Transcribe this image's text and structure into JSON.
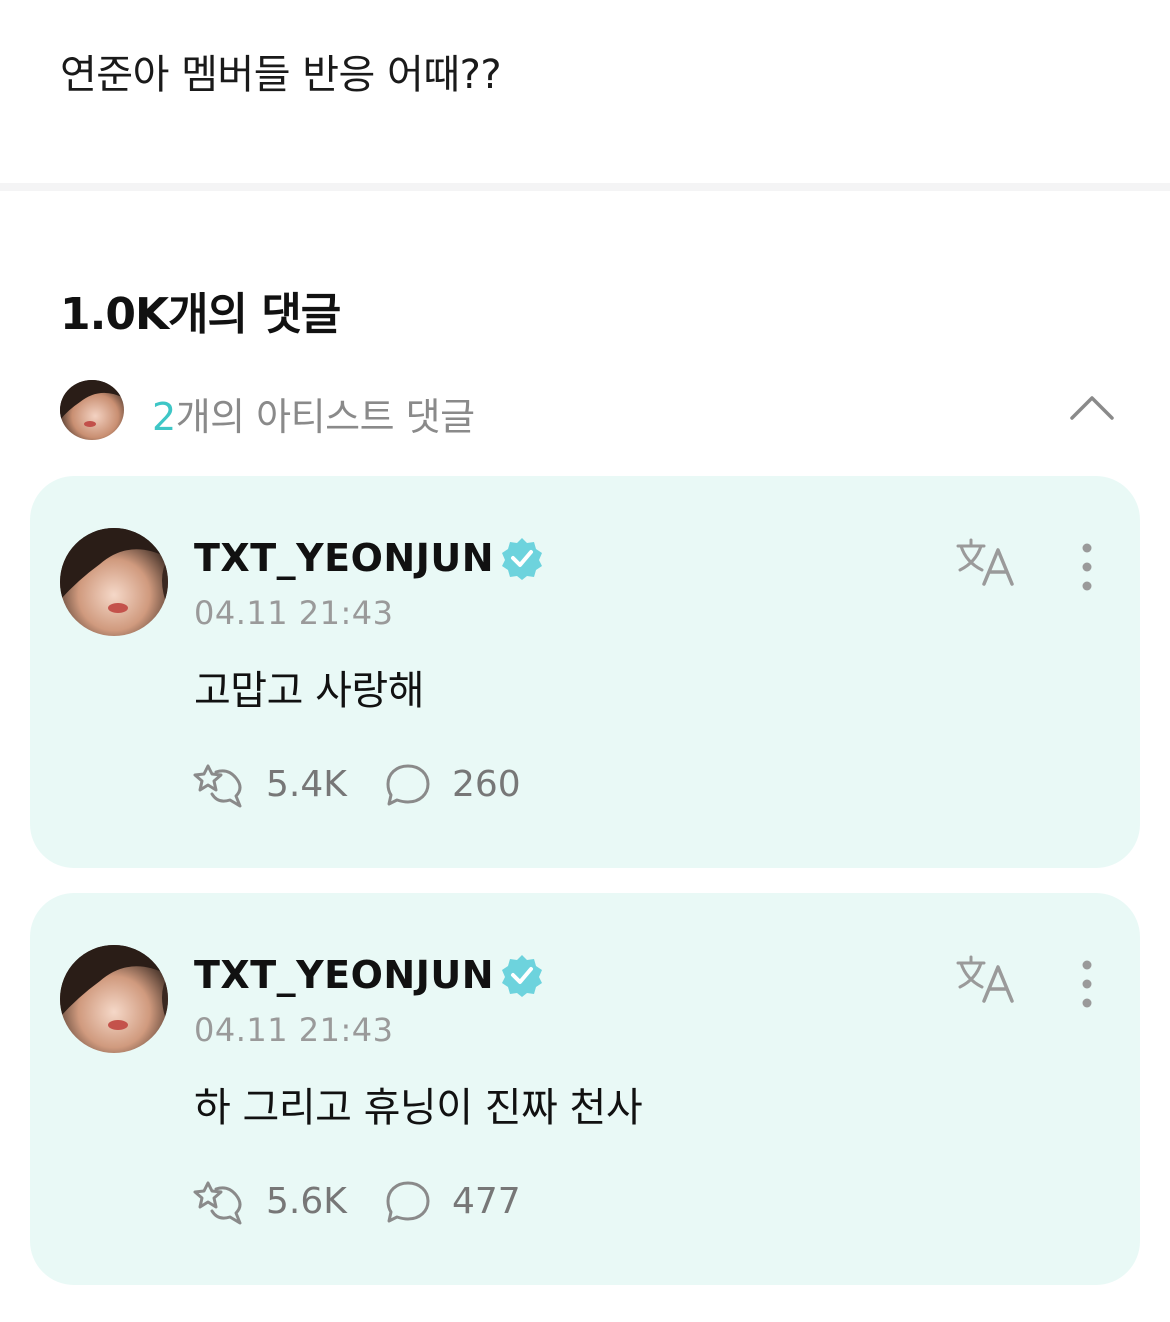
{
  "post": {
    "text": "연준아 멤버들 반응 어때??"
  },
  "comments_header": {
    "count_label": "1.0K개의 댓글"
  },
  "artist_section": {
    "count": "2",
    "label_suffix": "개의 아티스트 댓글",
    "toggle_icon": "chevron-up-icon"
  },
  "comments": [
    {
      "username": "TXT_YEONJUN",
      "verified": true,
      "timestamp": "04.11 21:43",
      "text": "고맙고 사랑해",
      "likes": "5.4K",
      "replies": "260"
    },
    {
      "username": "TXT_YEONJUN",
      "verified": true,
      "timestamp": "04.11 21:43",
      "text": "하 그리고 휴닝이 진짜 천사",
      "likes": "5.6K",
      "replies": "477"
    }
  ],
  "colors": {
    "accent": "#3ec6c6",
    "card_bg": "#e9f9f6",
    "verified_badge": "#6dd3dd",
    "muted_text": "#8a8a8a"
  }
}
